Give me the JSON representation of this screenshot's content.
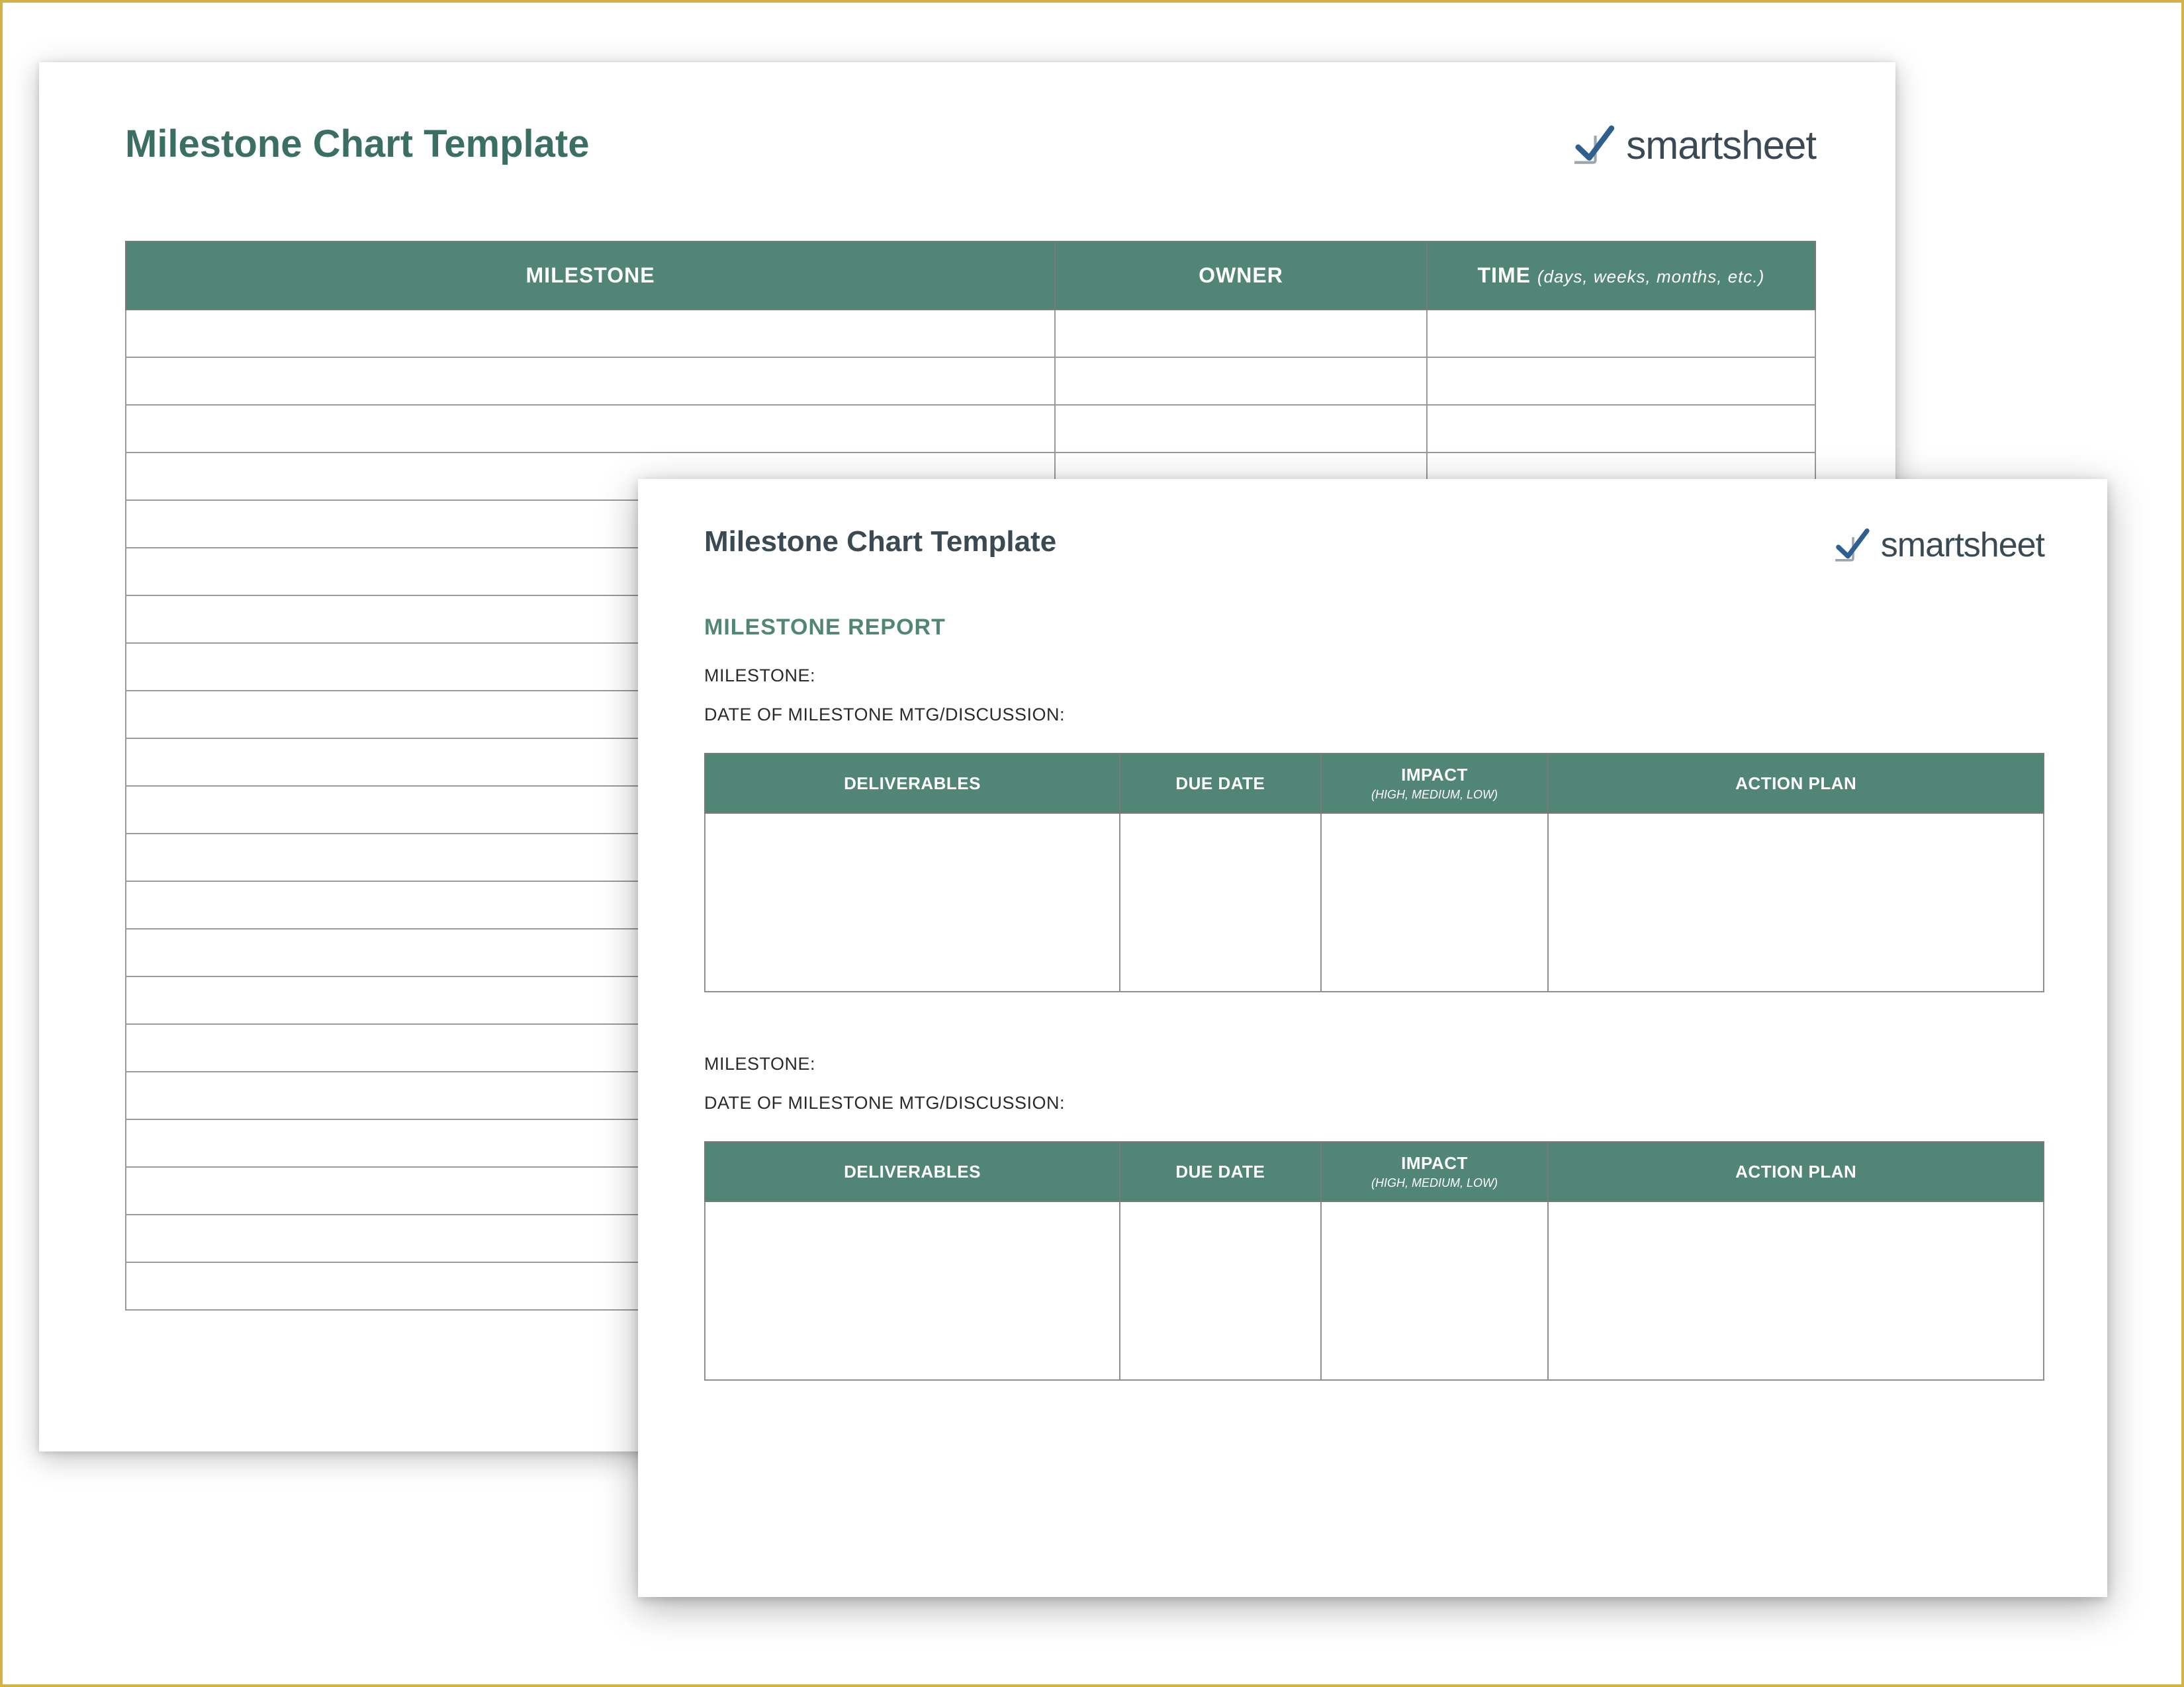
{
  "brand": {
    "name": "smartsheet"
  },
  "back": {
    "title": "Milestone Chart Template",
    "columns": {
      "milestone": "MILESTONE",
      "owner": "OWNER",
      "time": "TIME",
      "time_hint": "(days, weeks, months, etc.)"
    },
    "row_count": 21
  },
  "front": {
    "title": "Milestone Chart Template",
    "section": "MILESTONE REPORT",
    "fields": {
      "milestone": "MILESTONE:",
      "date_mtg": "DATE OF MILESTONE MTG/DISCUSSION:"
    },
    "columns": {
      "deliverables": "DELIVERABLES",
      "due_date": "DUE DATE",
      "impact": "IMPACT",
      "impact_hint": "(HIGH, MEDIUM, LOW)",
      "action_plan": "ACTION PLAN"
    }
  }
}
